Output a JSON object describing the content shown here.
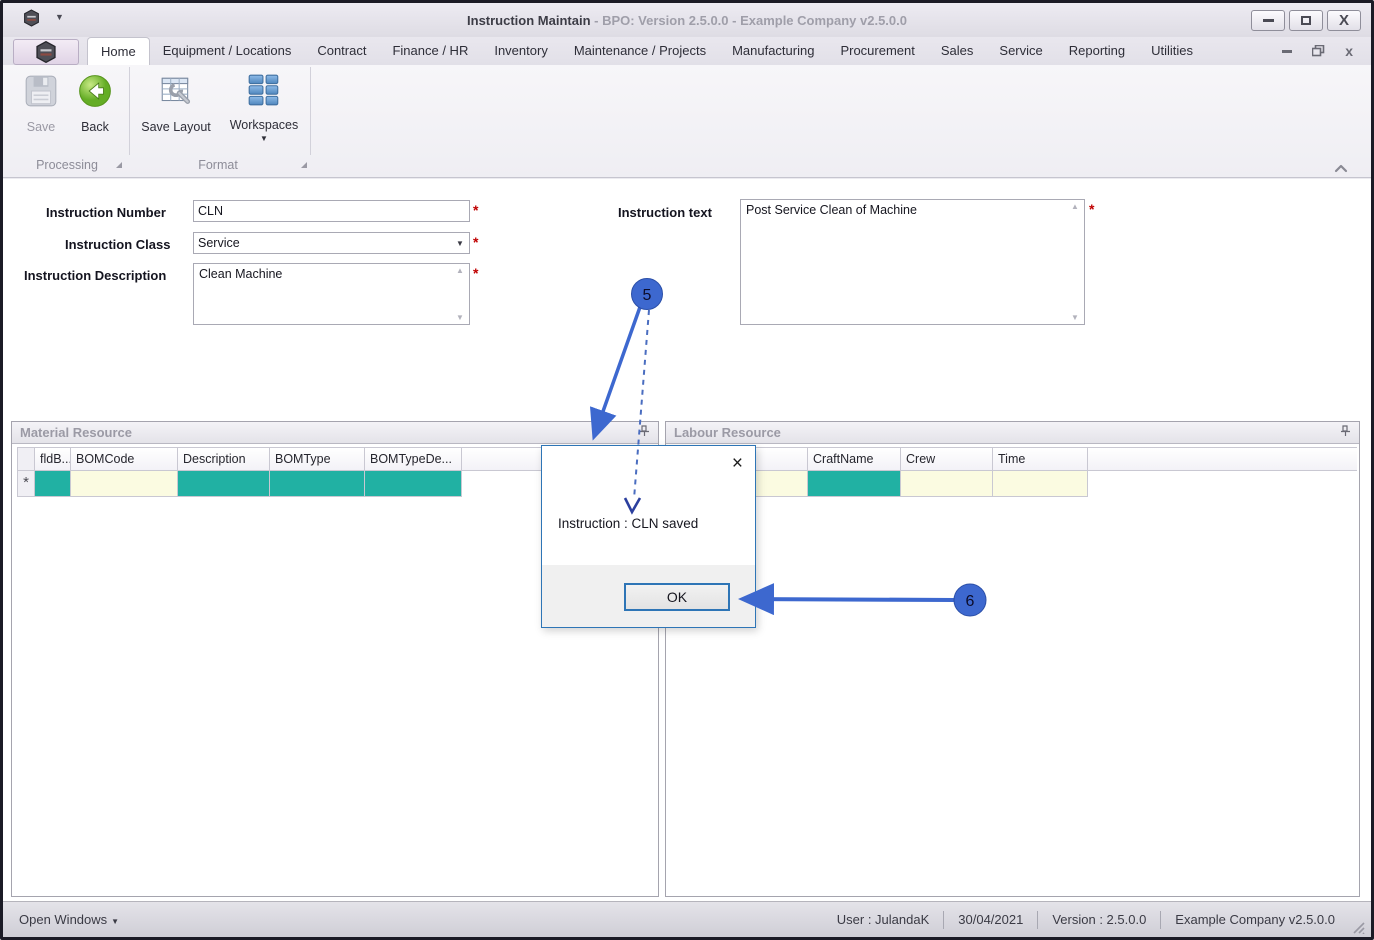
{
  "window": {
    "title": "Instruction Maintain",
    "title_suffix": " - BPO: Version 2.5.0.0 - Example Company v2.5.0.0"
  },
  "menu": {
    "tabs": [
      "Home",
      "Equipment / Locations",
      "Contract",
      "Finance / HR",
      "Inventory",
      "Maintenance / Projects",
      "Manufacturing",
      "Procurement",
      "Sales",
      "Service",
      "Reporting",
      "Utilities"
    ]
  },
  "ribbon": {
    "buttons": {
      "save": "Save",
      "back": "Back",
      "save_layout": "Save Layout",
      "workspaces": "Workspaces"
    },
    "groups": {
      "processing": "Processing",
      "format": "Format"
    }
  },
  "form": {
    "instruction_number": {
      "label": "Instruction Number",
      "value": "CLN",
      "required": "*"
    },
    "instruction_class": {
      "label": "Instruction Class",
      "value": "Service",
      "required": "*"
    },
    "instruction_description": {
      "label": "Instruction Description",
      "value": "Clean Machine",
      "required": "*"
    },
    "instruction_text": {
      "label": "Instruction text",
      "value": "Post Service Clean of Machine",
      "required": "*"
    }
  },
  "material_panel": {
    "title": "Material Resource",
    "columns": [
      "fldB...",
      "BOMCode",
      "Description",
      "BOMType",
      "BOMTypeDe..."
    ],
    "new_row_indicator": "*"
  },
  "labour_panel": {
    "title": "Labour Resource",
    "columns": [
      "CraftName",
      "Crew",
      "Time"
    ]
  },
  "dialog": {
    "message": "Instruction : CLN saved",
    "ok_label": "OK",
    "close_glyph": "×"
  },
  "callouts": {
    "five": "5",
    "six": "6"
  },
  "status_bar": {
    "open_windows": "Open Windows",
    "user": "User : JulandaK",
    "date": "30/04/2021",
    "version": "Version : 2.5.0.0",
    "company": "Example Company v2.5.0.0"
  },
  "colors": {
    "cell_teal": "#21b1a3",
    "cell_cream": "#fbfbe1",
    "callout_blue": "#3d68cf",
    "dialog_border": "#2e75b6",
    "required_red": "#c00000",
    "back_green": "#6cb52d"
  }
}
